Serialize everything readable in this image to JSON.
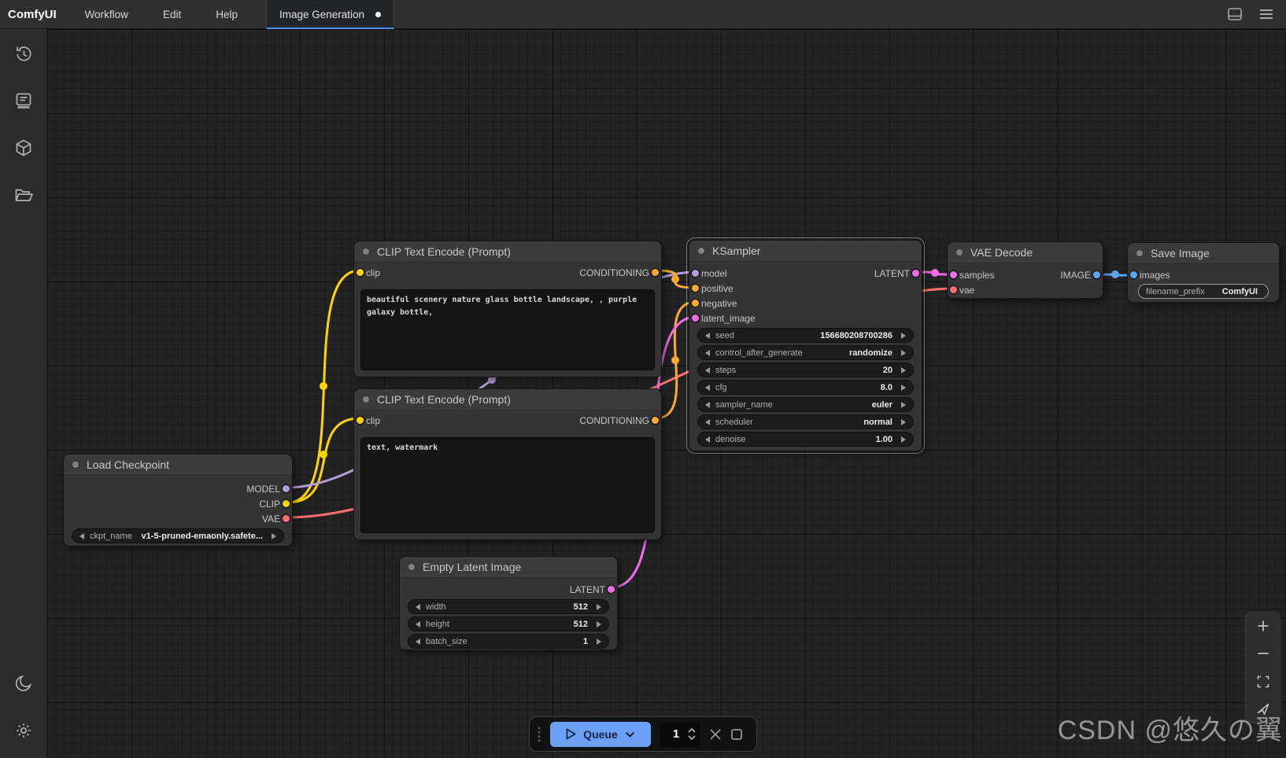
{
  "menubar": {
    "logo": "ComfyUI",
    "menus": [
      "Workflow",
      "Edit",
      "Help"
    ],
    "tab": {
      "label": "Image Generation"
    },
    "right_icons": [
      "panel-bottom-icon",
      "menu-icon"
    ]
  },
  "sidebar": {
    "top_icons": [
      "history-icon",
      "queue-log-icon",
      "node-library-icon",
      "workflows-folder-icon"
    ],
    "bottom_icons": [
      "theme-moon-icon",
      "settings-gear-icon"
    ]
  },
  "nodes": {
    "load_checkpoint": {
      "title": "Load Checkpoint",
      "outputs": [
        {
          "label": "MODEL"
        },
        {
          "label": "CLIP"
        },
        {
          "label": "VAE"
        }
      ],
      "widgets": [
        {
          "label": "ckpt_name",
          "value": "v1-5-pruned-emaonly.safete..."
        }
      ]
    },
    "clip_text_encode_positive": {
      "title": "CLIP Text Encode (Prompt)",
      "inputs": [
        {
          "label": "clip"
        }
      ],
      "outputs": [
        {
          "label": "CONDITIONING"
        }
      ],
      "text": "beautiful scenery nature glass bottle landscape, , purple galaxy bottle,"
    },
    "clip_text_encode_negative": {
      "title": "CLIP Text Encode (Prompt)",
      "inputs": [
        {
          "label": "clip"
        }
      ],
      "outputs": [
        {
          "label": "CONDITIONING"
        }
      ],
      "text": "text, watermark"
    },
    "empty_latent_image": {
      "title": "Empty Latent Image",
      "outputs": [
        {
          "label": "LATENT"
        }
      ],
      "widgets": [
        {
          "label": "width",
          "value": "512"
        },
        {
          "label": "height",
          "value": "512"
        },
        {
          "label": "batch_size",
          "value": "1"
        }
      ]
    },
    "ksampler": {
      "title": "KSampler",
      "inputs": [
        {
          "label": "model"
        },
        {
          "label": "positive"
        },
        {
          "label": "negative"
        },
        {
          "label": "latent_image"
        }
      ],
      "outputs": [
        {
          "label": "LATENT"
        }
      ],
      "widgets": [
        {
          "label": "seed",
          "value": "156680208700286"
        },
        {
          "label": "control_after_generate",
          "value": "randomize"
        },
        {
          "label": "steps",
          "value": "20"
        },
        {
          "label": "cfg",
          "value": "8.0"
        },
        {
          "label": "sampler_name",
          "value": "euler"
        },
        {
          "label": "scheduler",
          "value": "normal"
        },
        {
          "label": "denoise",
          "value": "1.00"
        }
      ]
    },
    "vae_decode": {
      "title": "VAE Decode",
      "inputs": [
        {
          "label": "samples"
        },
        {
          "label": "vae"
        }
      ],
      "outputs": [
        {
          "label": "IMAGE"
        }
      ]
    },
    "save_image": {
      "title": "Save Image",
      "inputs": [
        {
          "label": "images"
        }
      ],
      "widgets": [
        {
          "label": "filename_prefix",
          "value": "ComfyUI"
        }
      ]
    }
  },
  "queue_bar": {
    "queue_label": "Queue",
    "batch_count": "1"
  },
  "colors": {
    "clip": "#ffd500",
    "model": "#b39ddb",
    "vae": "#ff6e6e",
    "conditioning": "#ffa931",
    "latent": "#f06ce8",
    "image": "#5aa7f0",
    "accent_blue": "#4f8df5",
    "queue_button": "#6ca0f5"
  },
  "watermark": "CSDN @悠久の翼"
}
